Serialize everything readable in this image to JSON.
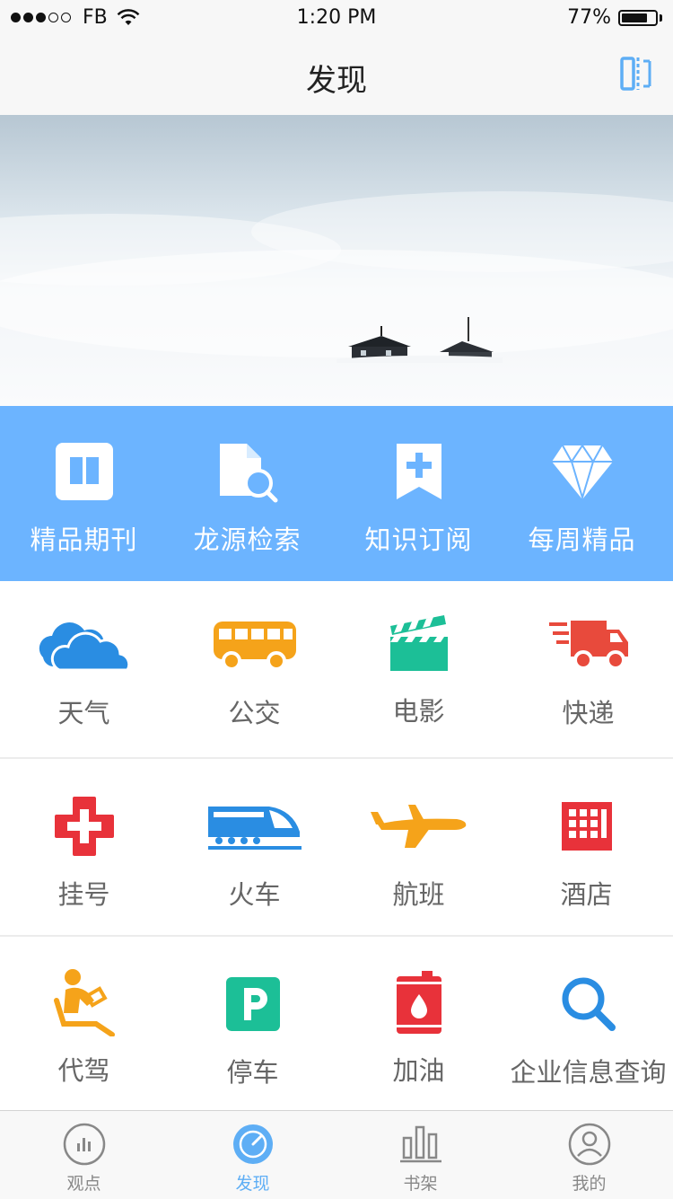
{
  "status_bar": {
    "carrier": "FB",
    "time": "1:20 PM",
    "battery_percent": "77%",
    "battery_level": 0.77
  },
  "nav": {
    "title": "发现",
    "action_icon": "reader-icon"
  },
  "features": [
    {
      "label": "精品期刊",
      "icon": "book-icon"
    },
    {
      "label": "龙源检索",
      "icon": "document-search-icon"
    },
    {
      "label": "知识订阅",
      "icon": "bookmark-add-icon"
    },
    {
      "label": "每周精品",
      "icon": "diamond-icon"
    }
  ],
  "services": [
    {
      "label": "天气",
      "icon": "cloud-icon"
    },
    {
      "label": "公交",
      "icon": "bus-icon"
    },
    {
      "label": "电影",
      "icon": "clapperboard-icon"
    },
    {
      "label": "快递",
      "icon": "delivery-truck-icon"
    },
    {
      "label": "挂号",
      "icon": "medical-cross-icon"
    },
    {
      "label": "火车",
      "icon": "train-icon"
    },
    {
      "label": "航班",
      "icon": "airplane-icon"
    },
    {
      "label": "酒店",
      "icon": "hotel-icon"
    },
    {
      "label": "代驾",
      "icon": "driver-icon"
    },
    {
      "label": "停车",
      "icon": "parking-icon"
    },
    {
      "label": "加油",
      "icon": "fuel-barrel-icon"
    },
    {
      "label": "企业信息查询",
      "icon": "magnifier-icon"
    }
  ],
  "tabs": [
    {
      "label": "观点",
      "icon": "chart-circle-icon",
      "active": false
    },
    {
      "label": "发现",
      "icon": "compass-icon",
      "active": true
    },
    {
      "label": "书架",
      "icon": "bookshelf-icon",
      "active": false
    },
    {
      "label": "我的",
      "icon": "user-icon",
      "active": false
    }
  ],
  "colors": {
    "accent_blue": "#6cb4ff",
    "weather": "#2a8de2",
    "bus": "#f5a31a",
    "movie": "#1cbf97",
    "delivery": "#e84a3c",
    "tab_active": "#5eaef5"
  }
}
